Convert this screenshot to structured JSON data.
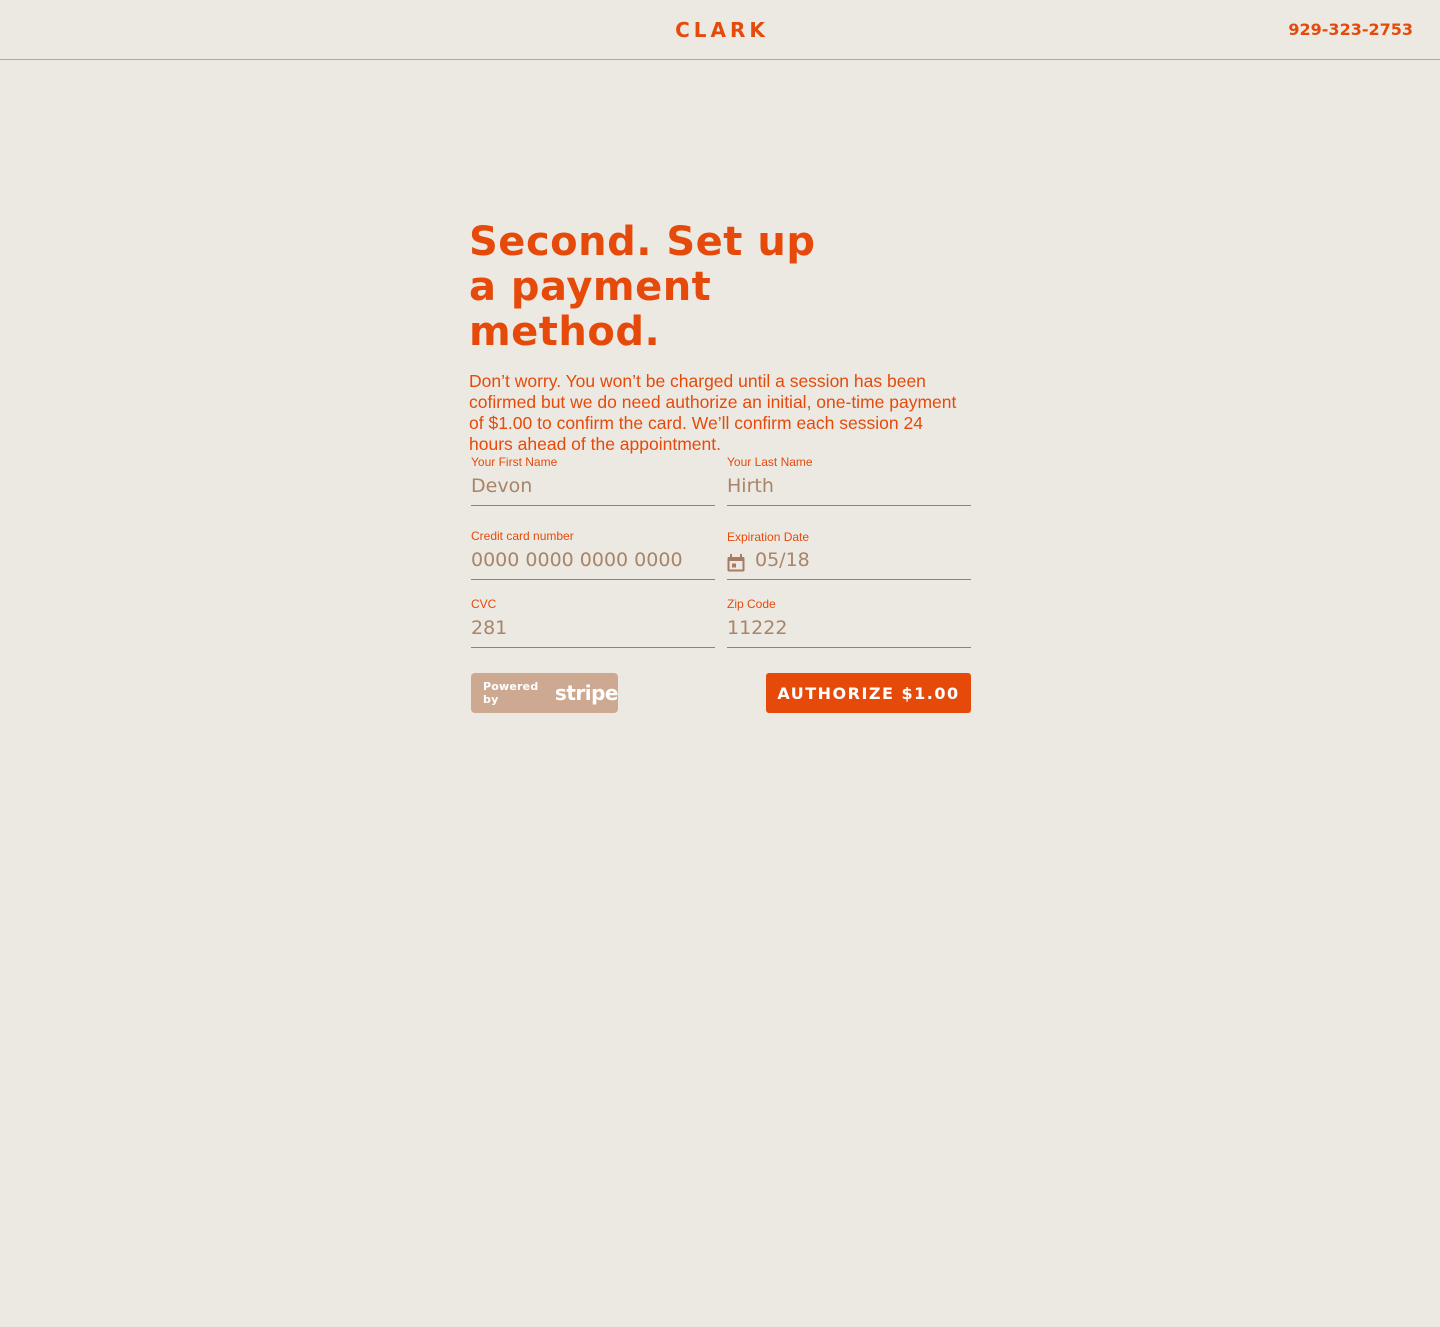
{
  "header": {
    "logo": "CLARK",
    "phone": "929-323-2753"
  },
  "main": {
    "headline": "Second. Set up a payment method.",
    "intro": "Don’t worry. You won’t be charged until a session has been cofirmed but we do need authorize an initial, one-time payment of $1.00 to confirm the card. We’ll confirm each session 24 hours ahead of the appointment."
  },
  "form": {
    "first_name": {
      "label": "Your First Name",
      "placeholder": "Devon"
    },
    "last_name": {
      "label": "Your Last Name",
      "placeholder": "Hirth"
    },
    "card_number": {
      "label": "Credit card number",
      "placeholder": "0000 0000 0000 0000"
    },
    "expiration": {
      "label": "Expiration Date",
      "placeholder": "05/18",
      "icon": "calendar-icon"
    },
    "cvc": {
      "label": "CVC",
      "placeholder": "281"
    },
    "zip": {
      "label": "Zip Code",
      "placeholder": "11222"
    }
  },
  "footer": {
    "powered_by": "Powered by",
    "stripe_wordmark": "stripe",
    "authorize_label": "AUTHORIZE $1.00"
  },
  "colors": {
    "background": "#ECE9E2",
    "accent": "#E64A0B",
    "muted_text": "#A88469",
    "badge": "#CEA992"
  }
}
